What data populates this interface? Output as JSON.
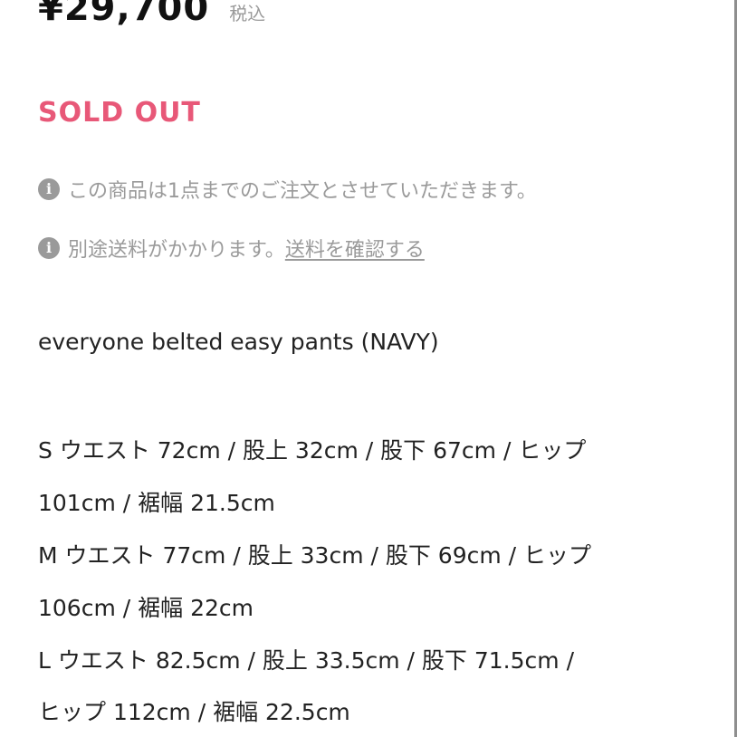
{
  "price": {
    "amount": "¥29,700",
    "tax_label": "税込"
  },
  "status": {
    "sold_out": "SOLD OUT"
  },
  "notices": {
    "icon": "info-icon",
    "icon_glyph": "i",
    "order_limit": "この商品は1点までのご注文とさせていただきます。",
    "shipping_text": "別途送料がかかります。",
    "shipping_link": "送料を確認する"
  },
  "product": {
    "name": "everyone belted easy pants (NAVY)"
  },
  "size_lines": [
    "S ウエスト 72cm / 股上 32cm / 股下 67cm / ヒップ",
    "101cm / 裾幅 21.5cm",
    "M ウエスト 77cm / 股上 33cm / 股下 69cm / ヒップ",
    "106cm / 裾幅 22cm",
    "L ウエスト 82.5cm / 股上 33.5cm / 股下 71.5cm /",
    "ヒップ 112cm / 裾幅 22.5cm"
  ],
  "colors": {
    "sold_out": "#e85878",
    "muted_text": "#9a9a9a",
    "body_text": "#222222"
  }
}
